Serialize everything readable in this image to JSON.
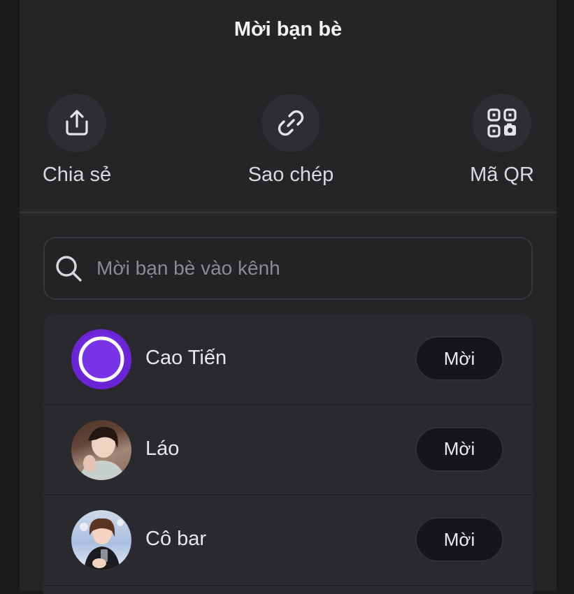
{
  "header": {
    "title": "Mời bạn bè"
  },
  "actions": [
    {
      "label": "Chia sẻ",
      "icon": "share-icon"
    },
    {
      "label": "Sao chép",
      "icon": "link-icon"
    },
    {
      "label": "Mã QR",
      "icon": "qr-code-icon"
    }
  ],
  "search": {
    "placeholder": "Mời bạn bè vào kênh",
    "icon": "search-icon"
  },
  "friends": [
    {
      "name": "Cao Tiến",
      "button": "Mời"
    },
    {
      "name": "Láo",
      "button": "Mời"
    },
    {
      "name": "Cô bar",
      "button": "Mời"
    }
  ],
  "colors": {
    "background": "#252528",
    "surface": "#2a2a2e",
    "button_bg": "#16161a",
    "accent_purple": "#7b2ff0"
  }
}
